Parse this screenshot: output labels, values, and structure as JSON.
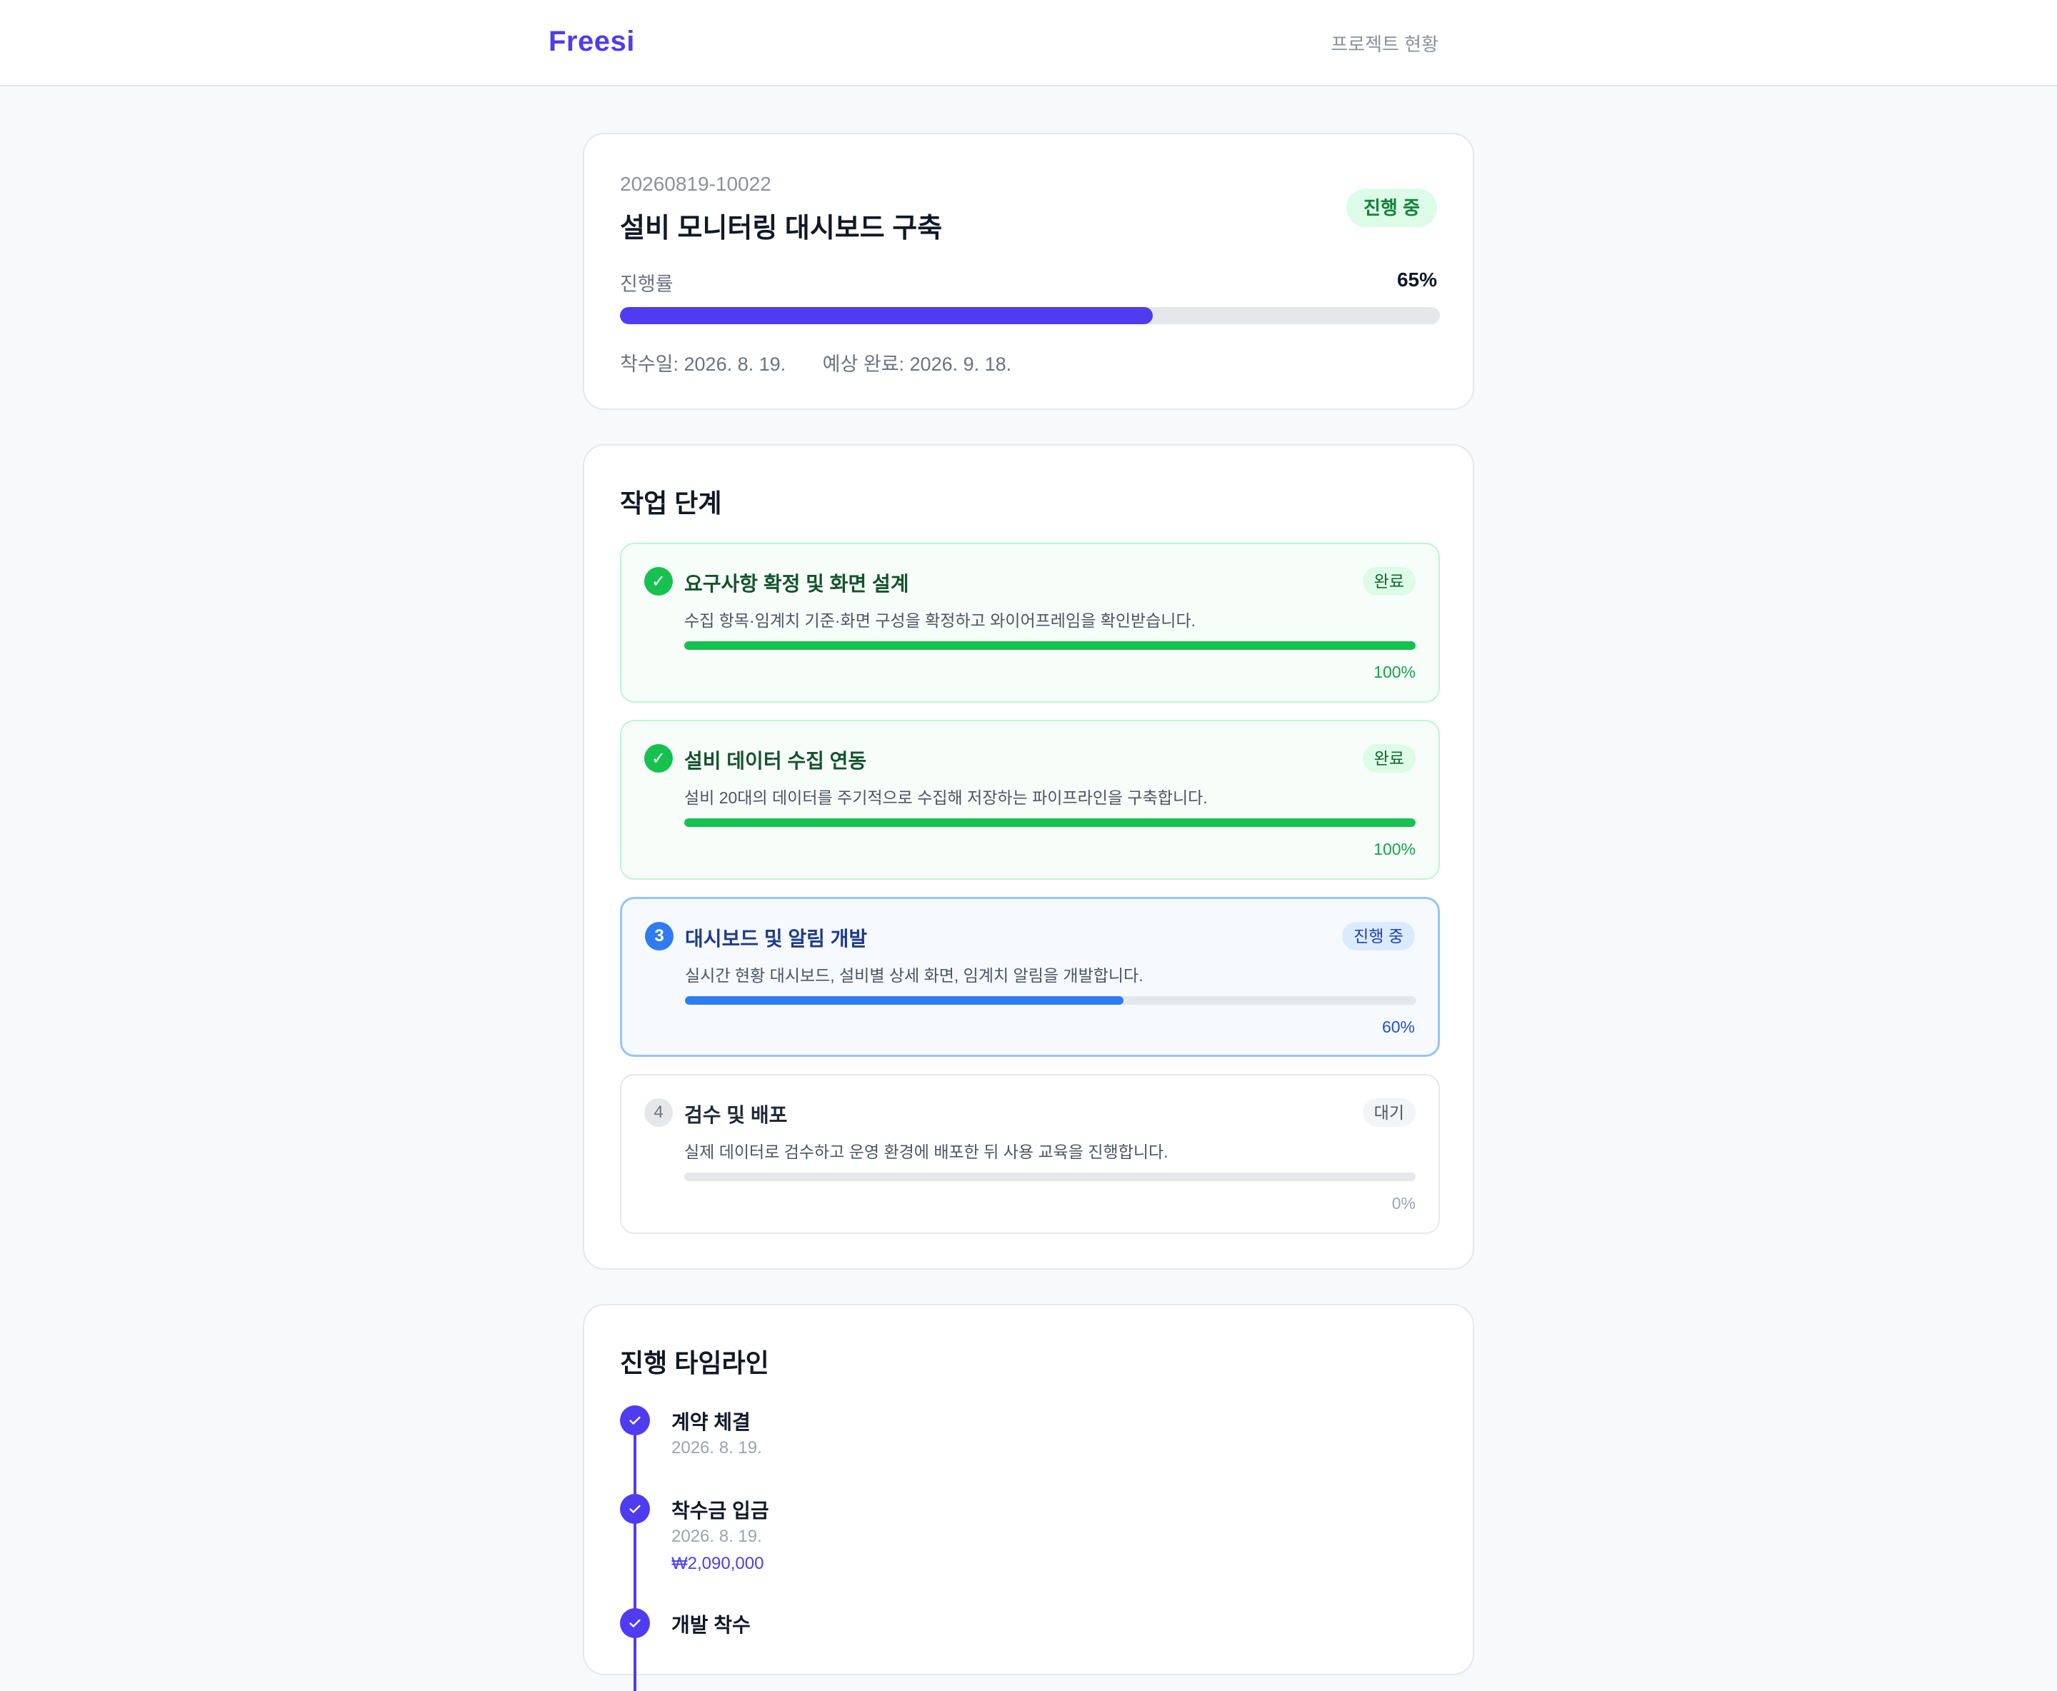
{
  "header": {
    "brand": "Freesi",
    "nav_link": "프로젝트 현황"
  },
  "summary": {
    "project_code": "20260819-10022",
    "title": "설비 모니터링 대시보드 구축",
    "status": "진행 중",
    "progress_label": "진행률",
    "progress_text": "65%",
    "progress_value": 65,
    "start_date": "착수일: 2026. 8. 19.",
    "expected_end": "예상 완료: 2026. 9. 18."
  },
  "steps": {
    "title": "작업 단계",
    "items": [
      {
        "badge": "✓",
        "title": "요구사항 확정 및 화면 설계",
        "tag": "완료",
        "desc": "수집 항목·임계치 기준·화면 구성을 확정하고 와이어프레임을 확인받습니다.",
        "pct_text": "100%",
        "pct": 100,
        "state": "done"
      },
      {
        "badge": "✓",
        "title": "설비 데이터 수집 연동",
        "tag": "완료",
        "desc": "설비 20대의 데이터를 주기적으로 수집해 저장하는 파이프라인을 구축합니다.",
        "pct_text": "100%",
        "pct": 100,
        "state": "done"
      },
      {
        "badge": "3",
        "title": "대시보드 및 알림 개발",
        "tag": "진행 중",
        "desc": "실시간 현황 대시보드, 설비별 상세 화면, 임계치 알림을 개발합니다.",
        "pct_text": "60%",
        "pct": 60,
        "state": "active"
      },
      {
        "badge": "4",
        "title": "검수 및 배포",
        "tag": "대기",
        "desc": "실제 데이터로 검수하고 운영 환경에 배포한 뒤 사용 교육을 진행합니다.",
        "pct_text": "0%",
        "pct": 0,
        "state": "wait"
      }
    ]
  },
  "timeline": {
    "title": "진행 타임라인",
    "items": [
      {
        "title": "계약 체결",
        "date": "2026. 8. 19."
      },
      {
        "title": "착수금 입금",
        "date": "2026. 8. 19.",
        "amount": "₩2,090,000"
      },
      {
        "title": "개발 착수"
      }
    ]
  },
  "colors": {
    "brand": "#4f3cf0",
    "done": "#16c150",
    "active": "#2f7cf0",
    "status_bg": "#dcfce7"
  }
}
